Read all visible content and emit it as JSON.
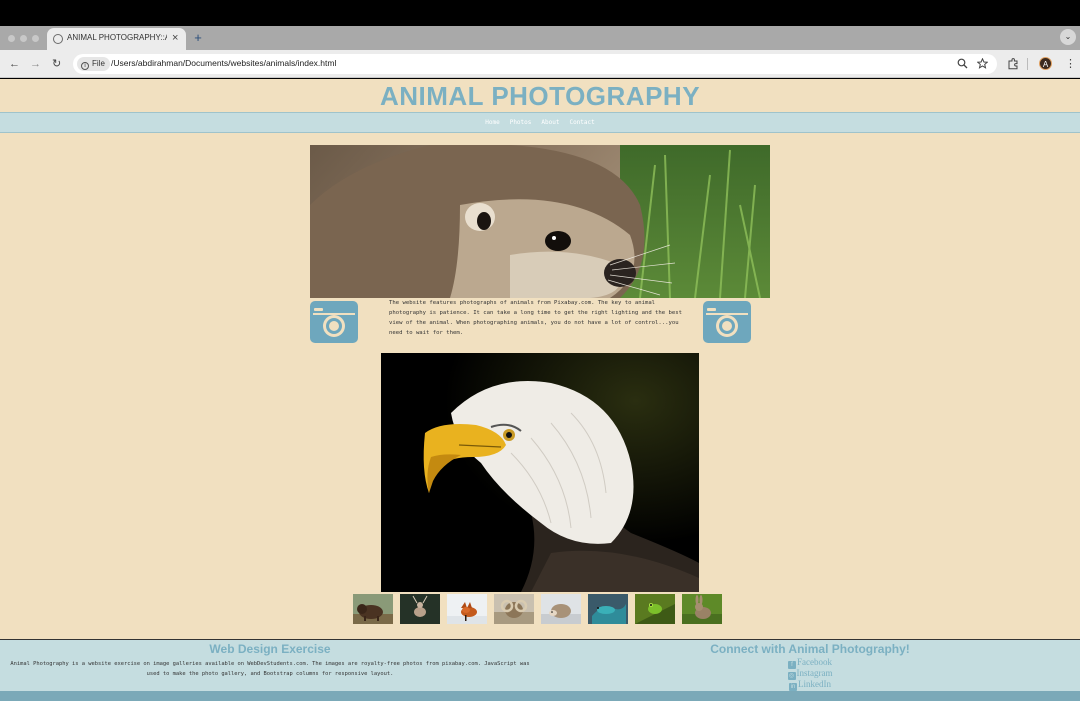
{
  "browser": {
    "tab_title": "ANIMAL PHOTOGRAPHY::Ani",
    "tab_close": "×",
    "new_tab": "+",
    "tab_menu": "⌄",
    "back": "←",
    "forward": "→",
    "reload": "↻",
    "file_chip": "File",
    "url": "/Users/abdirahman/Documents/websites/animals/index.html",
    "zoom_icon": "zoom-icon",
    "bookmark_icon": "star-icon",
    "extensions_icon": "puzzle-icon",
    "profile_initial": "A",
    "menu": "⋮"
  },
  "site": {
    "title": "ANIMAL PHOTOGRAPHY",
    "nav": [
      "Home",
      "Photos",
      "About",
      "Contact"
    ],
    "intro_text": "The website features photographs of animals from Pixabay.com. The key to animal photography is patience. It can take a long time to get the right lighting and the best view of the animal. When photographing animals, you do not have a lot of control...you need to wait for them.",
    "thumbnails": [
      "bison",
      "deer",
      "fox",
      "ram",
      "hedgehog",
      "lizard",
      "frog",
      "rabbit"
    ]
  },
  "footer": {
    "left_title": "Web Design Exercise",
    "left_text": "Animal Photography is a website exercise on image galleries available on WebDevStudents.com. The images are royalty-free photos from pixabay.com. JavaScript was used to make the photo gallery, and Bootstrap columns for responsive layout.",
    "right_title": "Connect with Animal Photography!",
    "social": [
      "Facebook",
      "Instagram",
      "LinkedIn"
    ]
  },
  "colors": {
    "page_bg": "#f1e0c0",
    "accent": "#7bb0c2",
    "nav_bg": "#c5dde0"
  }
}
